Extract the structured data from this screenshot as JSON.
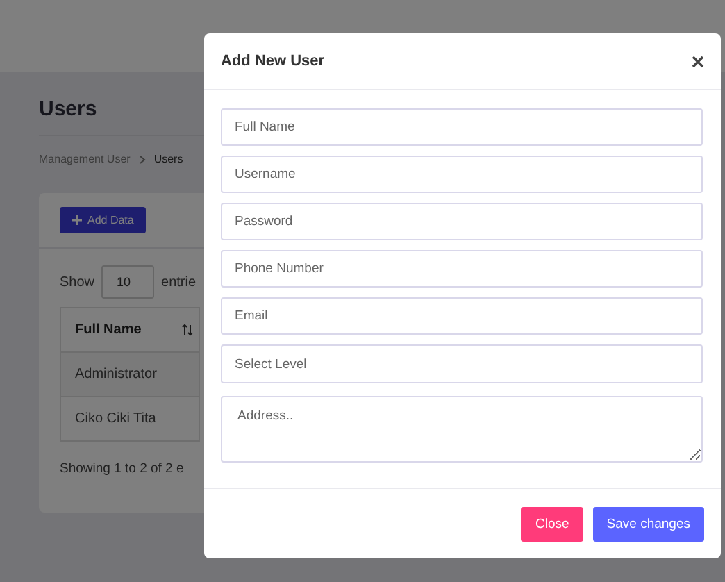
{
  "page": {
    "title": "Users",
    "breadcrumb": [
      {
        "label": "Management User"
      },
      {
        "label": "Users"
      }
    ],
    "add_button": "Add Data",
    "show_label": "Show",
    "entries_value": "10",
    "entries_label": "entrie",
    "table": {
      "columns": [
        {
          "label": "Full Name"
        }
      ],
      "rows": [
        [
          "Administrator"
        ],
        [
          "Ciko Ciki Tita"
        ]
      ]
    },
    "info": "Showing 1 to 2 of 2 e"
  },
  "modal": {
    "title": "Add New User",
    "fields": [
      {
        "kind": "input",
        "placeholder": "Full Name"
      },
      {
        "kind": "input",
        "placeholder": "Username"
      },
      {
        "kind": "input",
        "placeholder": "Password"
      },
      {
        "kind": "input",
        "placeholder": "Phone Number"
      },
      {
        "kind": "input",
        "placeholder": "Email"
      },
      {
        "kind": "select",
        "placeholder": "Select Level"
      },
      {
        "kind": "textarea",
        "placeholder": "Address.."
      }
    ],
    "buttons": [
      {
        "label": "Close",
        "kind": "danger"
      },
      {
        "label": "Save changes",
        "kind": "primary"
      }
    ]
  }
}
